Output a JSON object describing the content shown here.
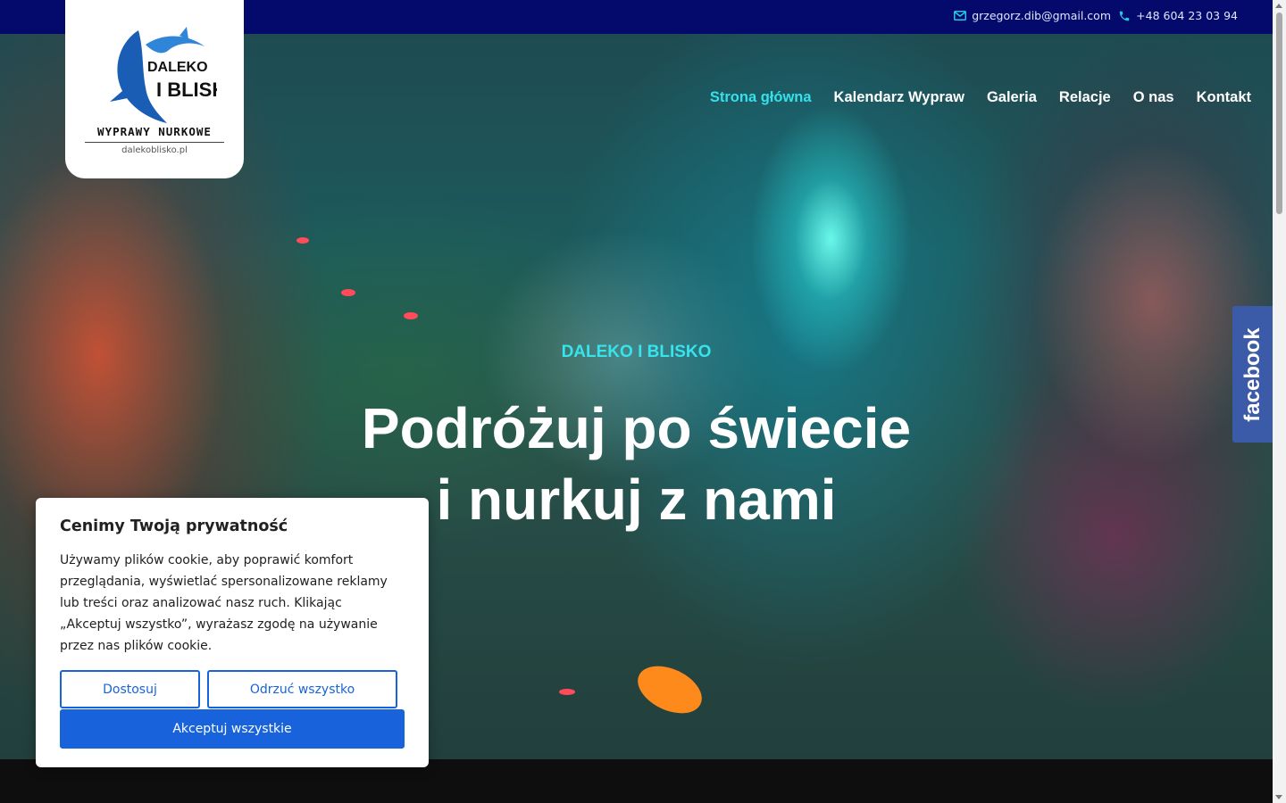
{
  "topbar": {
    "email": "grzegorz.dib@gmail.com",
    "phone": "+48 604 23 03 94"
  },
  "logo": {
    "brand_line1": "DALEKO",
    "brand_line2": "I BLISKO",
    "subtitle": "WYPRAWY NURKOWE",
    "url": "dalekoblisko.pl"
  },
  "nav": {
    "items": [
      {
        "label": "Strona główna",
        "active": true
      },
      {
        "label": "Kalendarz Wypraw",
        "active": false
      },
      {
        "label": "Galeria",
        "active": false
      },
      {
        "label": "Relacje",
        "active": false
      },
      {
        "label": "O nas",
        "active": false
      },
      {
        "label": "Kontakt",
        "active": false
      }
    ]
  },
  "hero": {
    "kicker": "DALEKO I BLISKO",
    "headline_line1": "Podróżuj po świecie",
    "headline_line2": "i nurkuj z nami"
  },
  "social": {
    "facebook_label": "facebook"
  },
  "cookie": {
    "title": "Cenimy Twoją prywatność",
    "text": "Używamy plików cookie, aby poprawić komfort przeglądania, wyświetlać spersonalizowane reklamy lub treści oraz analizować nasz ruch. Klikając „Akceptuj wszystko”, wyrażasz zgodę na używanie przez nas plików cookie.",
    "customize_label": "Dostosuj",
    "reject_label": "Odrzuć wszystko",
    "accept_label": "Akceptuj wszystkie"
  },
  "colors": {
    "topbar": "#030a6b",
    "accent_cyan": "#35e0ea",
    "button_blue": "#1863dc",
    "facebook": "#3b5ba8"
  },
  "icons": {
    "email": "envelope-icon",
    "phone": "phone-icon"
  }
}
